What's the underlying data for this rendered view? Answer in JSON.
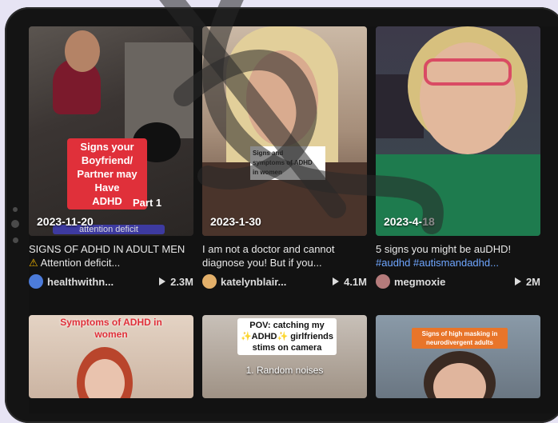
{
  "cards": [
    {
      "date": "2023-11-20",
      "overlay": [
        "Signs your",
        "Boyfriend/",
        "Partner may",
        "Have",
        "ADHD"
      ],
      "overlay_extra": "Part 1",
      "overlay_bottom": "attention deficit",
      "title": "SIGNS OF ADHD IN ADULT MEN",
      "title_warning": "⚠",
      "title_rest": "Attention deficit...",
      "author": "healthwithn...",
      "views": "2.3M"
    },
    {
      "date": "2023-1-30",
      "overlay": [
        "Signs and",
        "symptoms of ADHD",
        "in women"
      ],
      "title": "I am not a doctor and cannot diagnose you! But if you...",
      "author": "katelynblair...",
      "views": "4.1M"
    },
    {
      "date": "2023-4-18",
      "title_plain": "5 signs you might be auDHD!",
      "title_tags": "#audhd #autismandadhd...",
      "author": "megmoxie",
      "views": "2M"
    }
  ],
  "bottom_cards": [
    {
      "overlay": [
        "Symptoms of ADHD in",
        "women"
      ]
    },
    {
      "overlay": [
        "POV: catching my",
        "✨ADHD✨ girlfriends",
        "stims on camera"
      ],
      "sub": "1. Random noises"
    },
    {
      "overlay": [
        "Signs of high masking in",
        "neurodivergent adults"
      ]
    }
  ],
  "colors": {
    "accent_red": "#e0303a",
    "hashtag": "#6fa6ff",
    "background": "#121212"
  }
}
